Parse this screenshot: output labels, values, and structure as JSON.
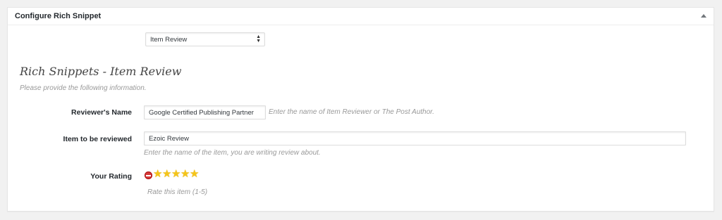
{
  "metabox": {
    "title": "Configure Rich Snippet",
    "collapse_icon": "triangle-up-icon"
  },
  "type_select": {
    "value": "Item Review"
  },
  "section": {
    "title": "Rich Snippets - Item Review",
    "description": "Please provide the following information."
  },
  "fields": {
    "reviewer_name": {
      "label": "Reviewer's Name",
      "value": "Google Certified Publishing Partner",
      "hint": "Enter the name of Item Reviewer or The Post Author."
    },
    "item_reviewed": {
      "label": "Item to be reviewed",
      "value": "Ezoic Review",
      "hint": "Enter the name of the item, you are writing review about."
    },
    "rating": {
      "label": "Your Rating",
      "value": 5,
      "max": 5,
      "hint": "Rate this item (1-5)"
    }
  },
  "colors": {
    "star": "#f5c518",
    "cancel": "#d73a3a"
  }
}
